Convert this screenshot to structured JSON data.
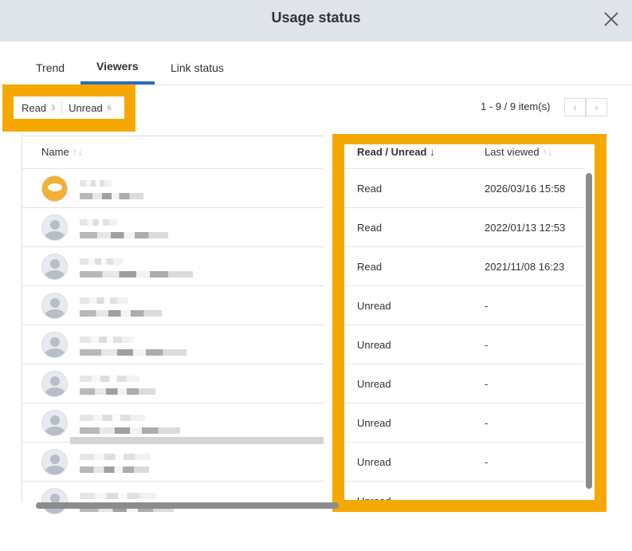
{
  "dialog": {
    "title": "Usage status",
    "close_icon": "close-icon"
  },
  "tabs": [
    {
      "label": "Trend"
    },
    {
      "label": "Viewers",
      "active": true
    },
    {
      "label": "Link status"
    }
  ],
  "filter": {
    "read_label": "Read",
    "read_count": "3",
    "unread_label": "Unread",
    "unread_count": "6"
  },
  "pager": {
    "text": "1 - 9 / 9 item(s)",
    "prev": "‹",
    "next": "›"
  },
  "columns": {
    "name": "Name",
    "status": "Read / Unread",
    "last_viewed": "Last viewed",
    "sort_icon": "↑↓",
    "sorted_icon": "↓"
  },
  "rows": [
    {
      "status": "Read",
      "last_viewed": "2026/03/16 15:58"
    },
    {
      "status": "Read",
      "last_viewed": "2022/01/13 12:53"
    },
    {
      "status": "Read",
      "last_viewed": "2021/11/08 16:23"
    },
    {
      "status": "Unread",
      "last_viewed": "-"
    },
    {
      "status": "Unread",
      "last_viewed": "-"
    },
    {
      "status": "Unread",
      "last_viewed": "-"
    },
    {
      "status": "Unread",
      "last_viewed": "-"
    },
    {
      "status": "Unread",
      "last_viewed": "-"
    },
    {
      "status": "Unread",
      "last_viewed": ""
    }
  ],
  "colors": {
    "highlight": "#f5a800",
    "tab_accent": "#2a6ebb",
    "header_bg": "#dfe3ea"
  }
}
